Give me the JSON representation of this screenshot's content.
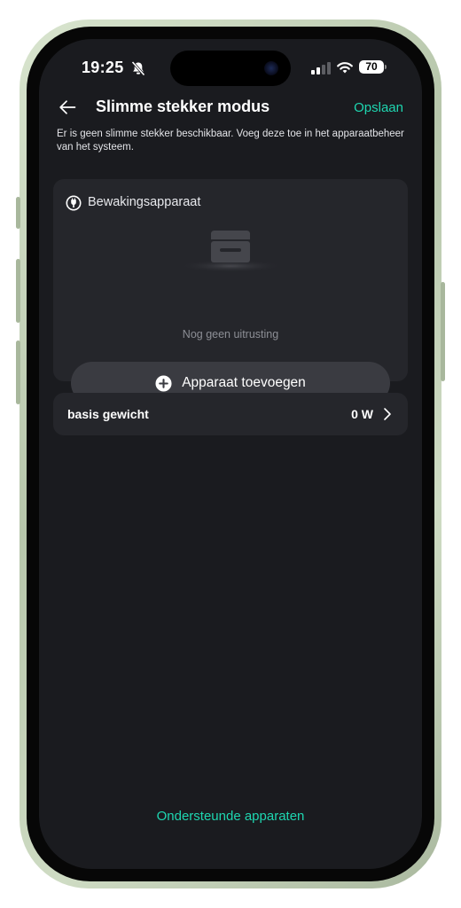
{
  "status_bar": {
    "time": "19:25",
    "battery": "70",
    "icons": [
      "bell-muted-icon",
      "signal-icon",
      "wifi-icon",
      "battery-icon"
    ]
  },
  "header": {
    "back_icon": "arrow-left-icon",
    "title": "Slimme stekker modus",
    "save_label": "Opslaan"
  },
  "info_text": "Er is geen slimme stekker beschikbaar. Voeg deze toe in het apparaatbeheer van het systeem.",
  "monitor_card": {
    "icon": "plug-icon",
    "label": "Bewakingsapparaat",
    "empty_icon": "empty-box-icon",
    "empty_text": "Nog geen uitrusting",
    "add_button_icon": "plus-circle-icon",
    "add_button_label": "Apparaat toevoegen"
  },
  "base_weight": {
    "label": "basis gewicht",
    "value": "0 W",
    "icon": "chevron-right-icon"
  },
  "footer_link": "Ondersteunde apparaten",
  "colors": {
    "accent": "#1ED6B0",
    "background": "#1A1B1F",
    "card": "#25262B",
    "button": "#3A3B41"
  }
}
